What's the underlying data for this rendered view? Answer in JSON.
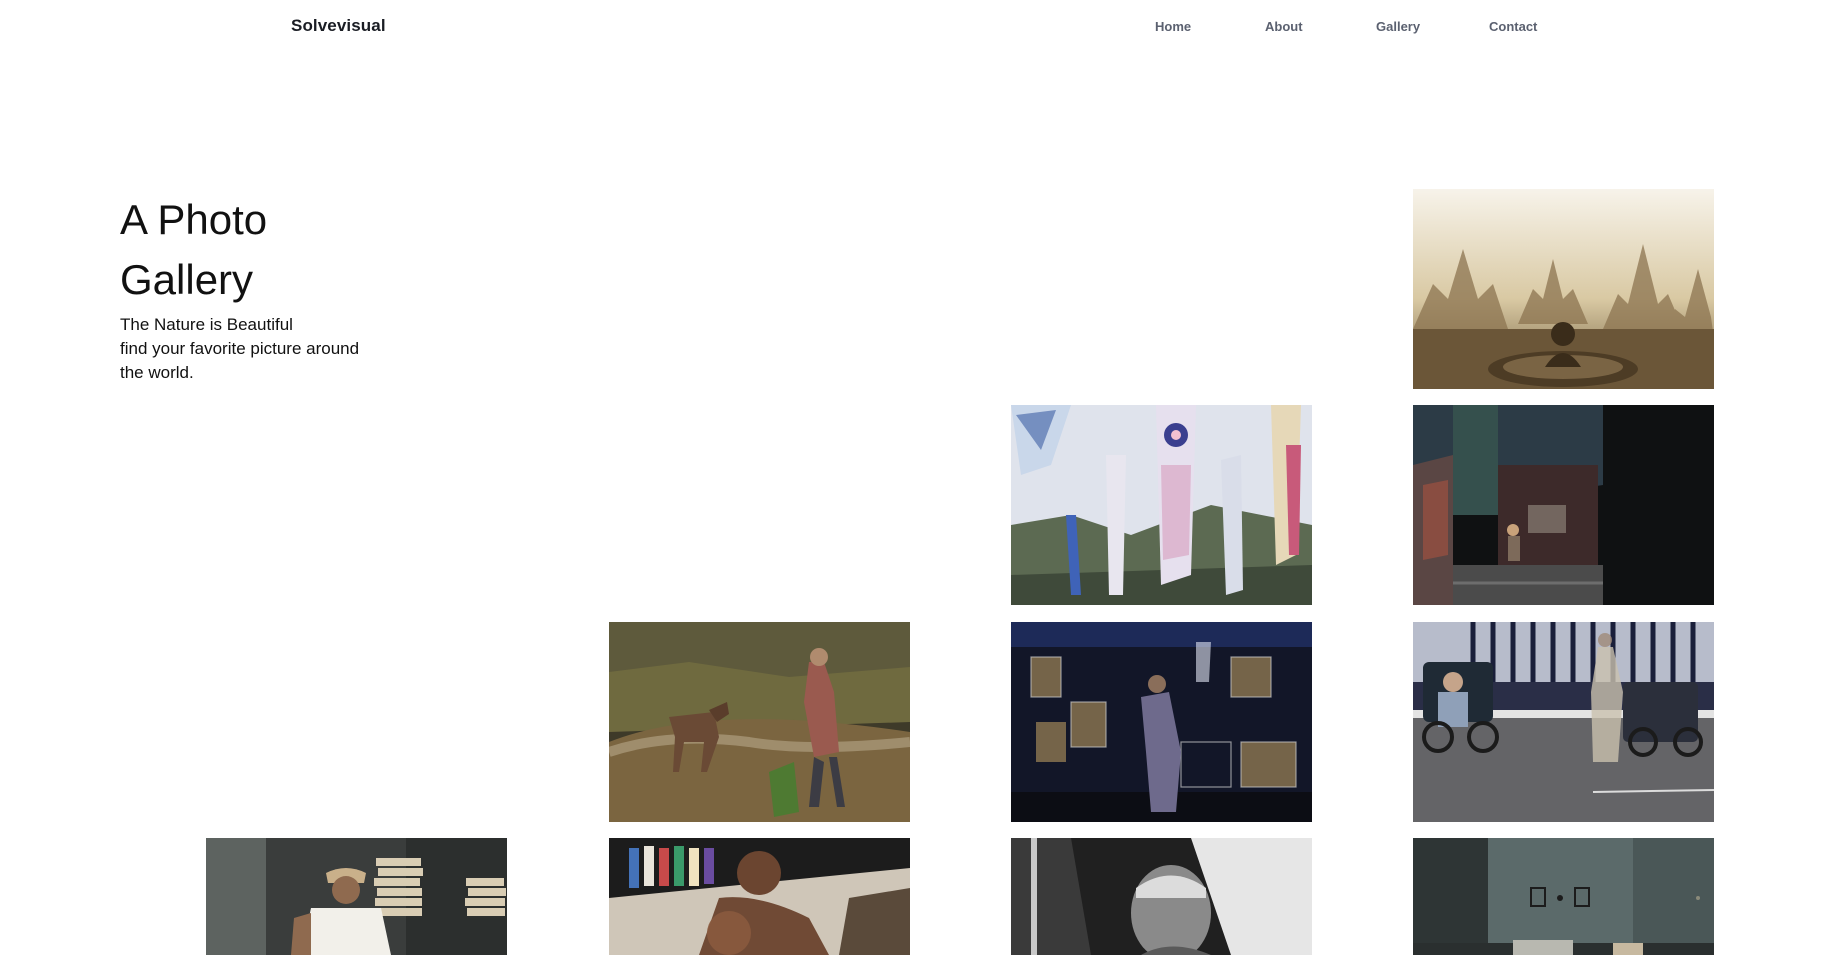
{
  "header": {
    "brand": "Solvevisual",
    "nav": [
      {
        "label": "Home"
      },
      {
        "label": "About"
      },
      {
        "label": "Gallery"
      },
      {
        "label": "Contact"
      }
    ]
  },
  "hero": {
    "title": "A Photo Gallery",
    "subtitle_line1": "The Nature is Beautiful",
    "subtitle_line2": "find your favorite picture around the world."
  },
  "gallery": {
    "photos": [
      {
        "subject": "temple-silhouette-in-mist"
      },
      {
        "subject": "koinobori-carp-flags"
      },
      {
        "subject": "person-sitting-in-dark-doorway"
      },
      {
        "subject": "woman-with-horse-on-hillside"
      },
      {
        "subject": "bird-cage-market"
      },
      {
        "subject": "rickshaw-street-scene"
      },
      {
        "subject": "man-reading-among-book-stacks"
      },
      {
        "subject": "man-reaching-hand-toward-camera"
      },
      {
        "subject": "black-and-white-portrait-old-man"
      },
      {
        "subject": "interior-room-with-frames"
      }
    ]
  }
}
